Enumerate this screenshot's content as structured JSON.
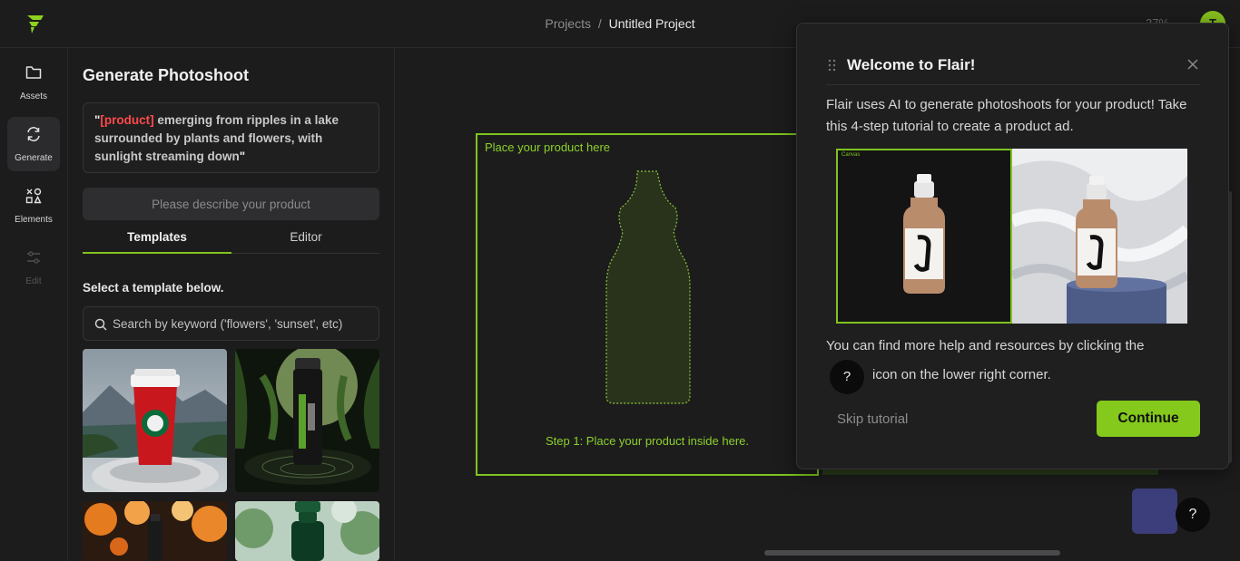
{
  "header": {
    "breadcrumb_root": "Projects",
    "breadcrumb_sep": "/",
    "breadcrumb_current": "Untitled Project",
    "zoom": "37%",
    "avatar_initial": "T"
  },
  "rail": {
    "items": [
      {
        "label": "Assets",
        "icon": "folder-icon"
      },
      {
        "label": "Generate",
        "icon": "refresh-icon"
      },
      {
        "label": "Elements",
        "icon": "shapes-icon"
      },
      {
        "label": "Edit",
        "icon": "sliders-icon"
      }
    ]
  },
  "panel": {
    "title": "Generate Photoshoot",
    "prompt_open_quote": "\"",
    "prompt_tag": "[product]",
    "prompt_text": " emerging from ripples in a lake surrounded by plants and flowers, with sunlight streaming down",
    "prompt_close_quote": "\"",
    "describe_placeholder": "Please describe your product",
    "tabs": [
      {
        "label": "Templates"
      },
      {
        "label": "Editor"
      }
    ],
    "select_label": "Select a template below.",
    "search_placeholder": "Search by keyword ('flowers', 'sunset', etc)"
  },
  "canvas": {
    "place_label": "Place your product here",
    "step_label": "Step 1: Place your product inside here.",
    "help_symbol": "?"
  },
  "dialog": {
    "title": "Welcome to Flair!",
    "intro": "Flair uses AI to generate photoshoots for your product! Take this 4-step tutorial to create a product ad.",
    "canvas_mini_label": "Canvas",
    "help_line1": "You can find more help and resources by clicking the",
    "help_symbol": "?",
    "help_line2": "icon on the lower right corner.",
    "skip_label": "Skip tutorial",
    "continue_label": "Continue"
  },
  "colors": {
    "accent": "#84c91c",
    "tag_red": "#ff4a4a"
  }
}
